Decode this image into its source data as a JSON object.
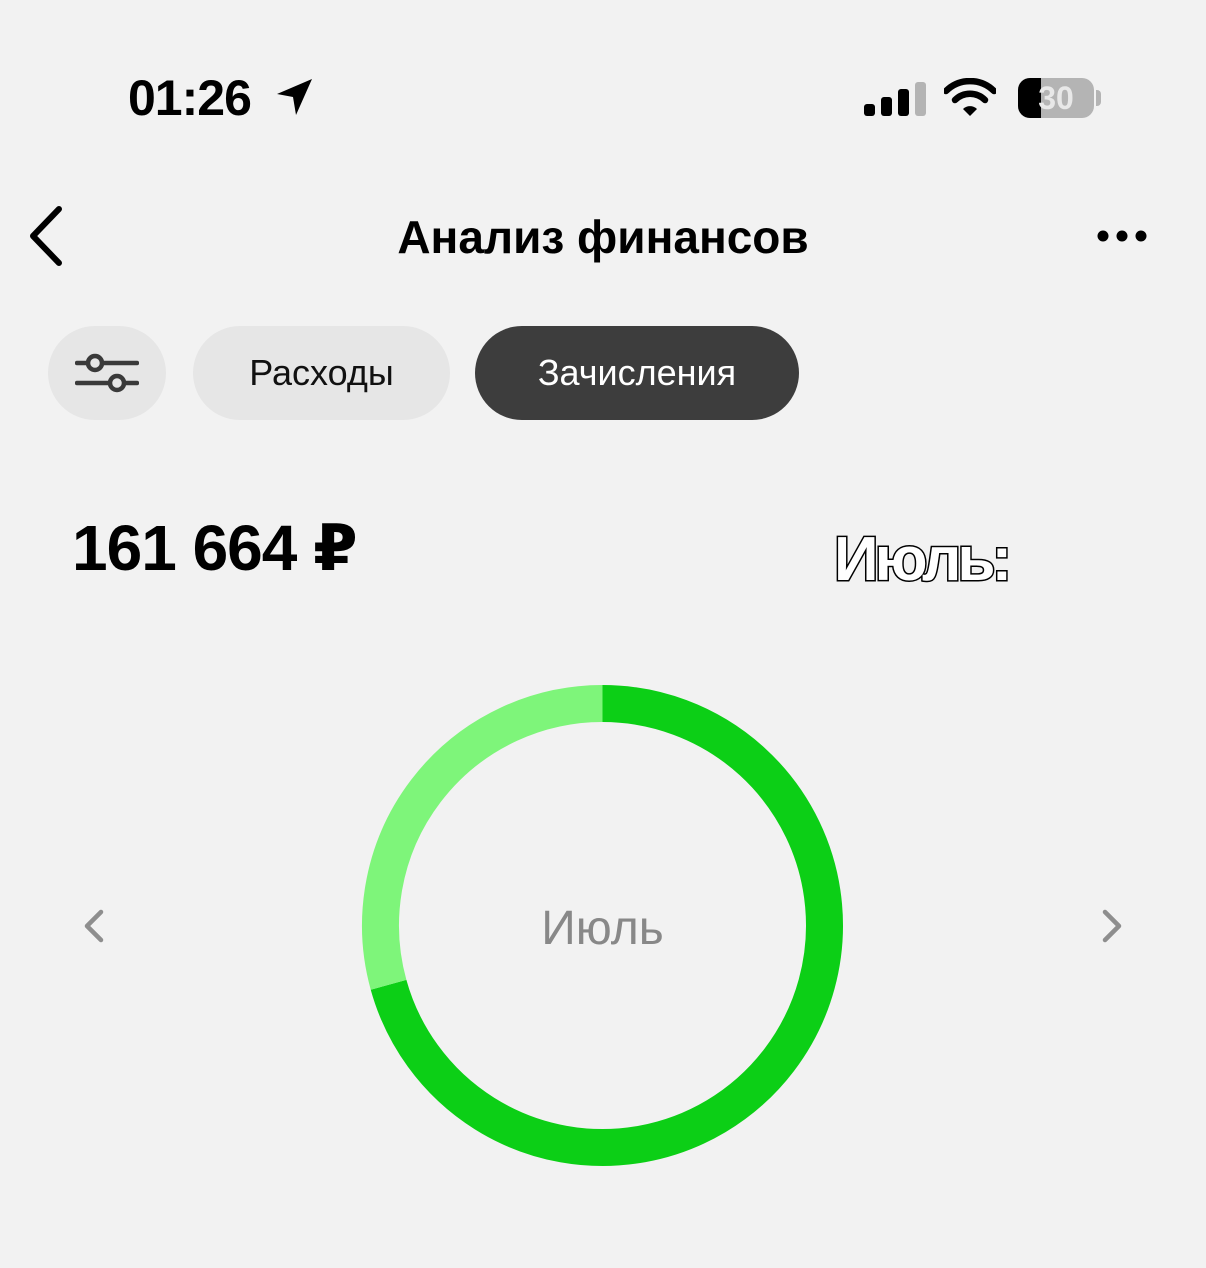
{
  "status_bar": {
    "time": "01:26",
    "battery_level": "30",
    "battery_percent": 30
  },
  "header": {
    "title": "Анализ финансов"
  },
  "filters": {
    "expenses_label": "Расходы",
    "income_label": "Зачисления",
    "active": "income"
  },
  "summary": {
    "total": "161 664 ₽",
    "month_overlay": "Июль:"
  },
  "chart": {
    "center_label": "Июль"
  },
  "colors": {
    "background": "#f2f2f2",
    "active_chip": "#3d3d3d",
    "chip": "#e6e6e6",
    "segment_main": "#0ccf16",
    "segment_light": "#7ef57a"
  },
  "icons": {
    "back": "chevron-left-icon",
    "more": "ellipsis-icon",
    "filter": "sliders-icon",
    "prev": "chevron-left-icon",
    "next": "chevron-right-icon"
  },
  "chart_data": {
    "type": "pie",
    "segments": [
      {
        "value": 70.7,
        "color": "#0ccf16"
      },
      {
        "value": 29.3,
        "color": "#7ef57a"
      }
    ]
  }
}
